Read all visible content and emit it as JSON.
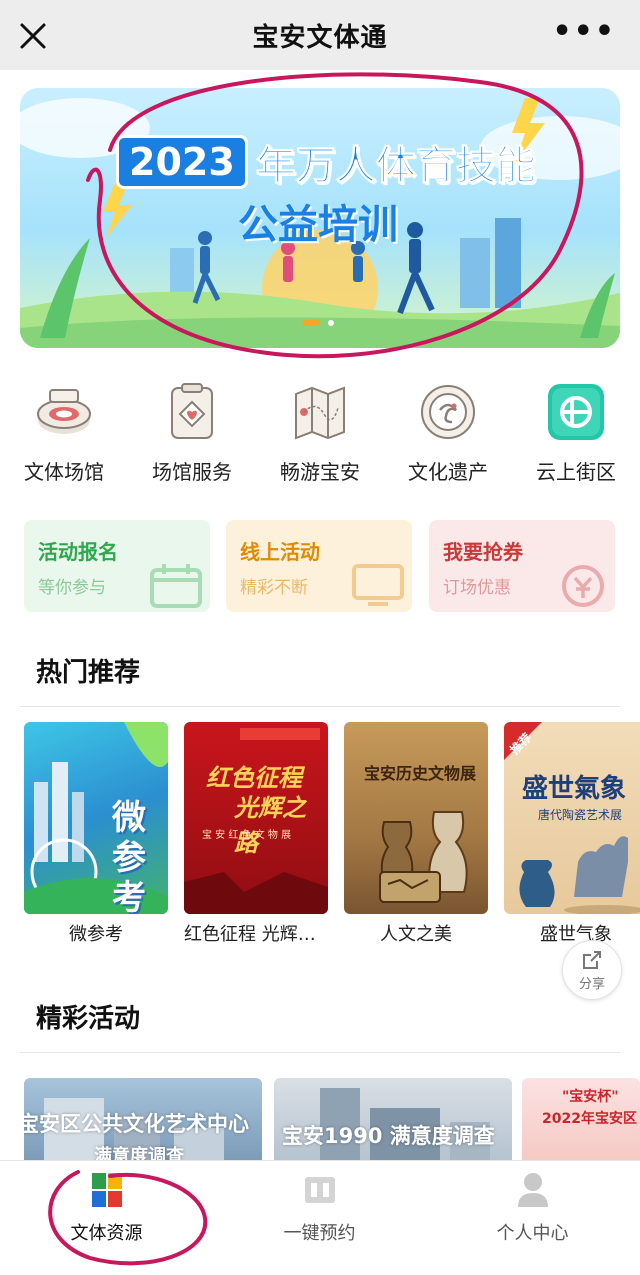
{
  "navbar": {
    "title": "宝安文体通",
    "more_label": "•••"
  },
  "banner": {
    "year": "2023",
    "line1": "年万人体育技能",
    "line2": "公益培训"
  },
  "icon_grid": [
    {
      "label": "文体场馆",
      "icon": "stadium-icon"
    },
    {
      "label": "场馆服务",
      "icon": "venue-service-icon"
    },
    {
      "label": "畅游宝安",
      "icon": "travel-map-icon"
    },
    {
      "label": "文化遗产",
      "icon": "heritage-icon"
    },
    {
      "label": "云上街区",
      "icon": "cloud-street-icon"
    }
  ],
  "promos": [
    {
      "title": "活动报名",
      "subtitle": "等你参与",
      "color": "#2ea84d",
      "bg": "#eaf7ec"
    },
    {
      "title": "线上活动",
      "subtitle": "精彩不断",
      "color": "#e08a00",
      "bg": "#fdf1dc"
    },
    {
      "title": "我要抢券",
      "subtitle": "订场优惠",
      "color": "#c83a3a",
      "bg": "#fbe9ea"
    }
  ],
  "hot": {
    "title": "热门推荐",
    "items": [
      {
        "label": "微参考",
        "cover_text": "微参考"
      },
      {
        "label": "红色征程 光辉之路",
        "cover_line1": "红色征程",
        "cover_line2": "光辉之路",
        "cover_sub": "宝 安 红 色 文 物 展"
      },
      {
        "label": "人文之美",
        "cover_text": "宝安历史文物展"
      },
      {
        "label": "盛世气象",
        "cover_text": "盛世氣象",
        "cover_sub": "唐代陶瓷艺术展",
        "badge": "推荐"
      }
    ]
  },
  "share": {
    "label": "分享"
  },
  "activities": {
    "title": "精彩活动",
    "cards": [
      {
        "text": "宝安区公共文化艺术中心",
        "text2": "满意度调查"
      },
      {
        "text": "宝安1990 满意度调查"
      },
      {
        "text": "\"宝安杯\"",
        "text2": "2022年宝安区"
      }
    ]
  },
  "tabbar": {
    "tabs": [
      {
        "label": "文体资源",
        "active": true
      },
      {
        "label": "一键预约",
        "active": false
      },
      {
        "label": "个人中心",
        "active": false
      }
    ]
  },
  "colors": {
    "accent_blue": "#1b80e4",
    "annotation": "#c8175d",
    "navbar_bg": "#ededed"
  }
}
